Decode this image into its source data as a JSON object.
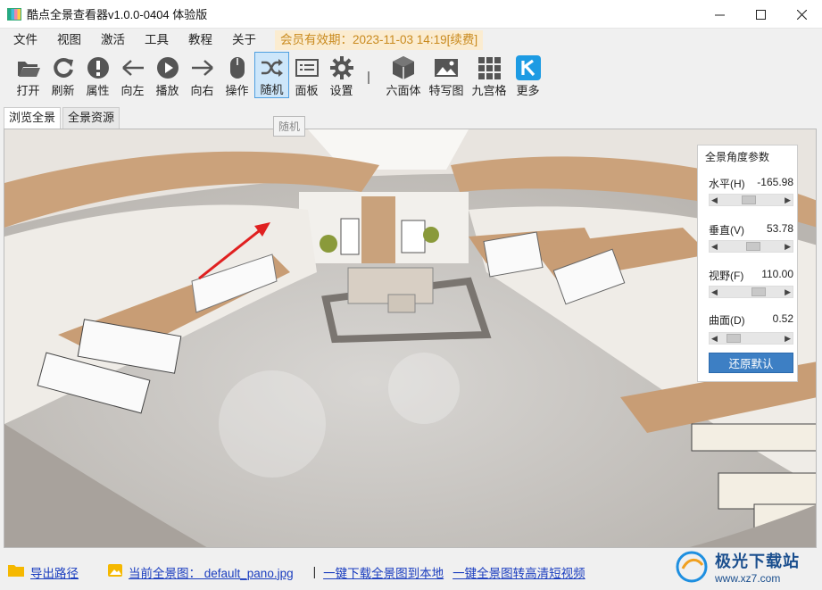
{
  "window": {
    "title": "酷点全景查看器v1.0.0-0404 体验版",
    "controls": [
      "minimize-icon",
      "maximize-icon",
      "close-icon"
    ]
  },
  "menu": {
    "items": [
      "文件",
      "视图",
      "激活",
      "工具",
      "教程",
      "关于"
    ],
    "member": "会员有效期：2023-11-03 14:19[续费]"
  },
  "toolbar": {
    "items": [
      {
        "label": "打开",
        "icon": "folder-open-icon"
      },
      {
        "label": "刷新",
        "icon": "refresh-icon"
      },
      {
        "label": "属性",
        "icon": "info-icon"
      },
      {
        "label": "向左",
        "icon": "arrow-left-icon"
      },
      {
        "label": "播放",
        "icon": "play-icon"
      },
      {
        "label": "向右",
        "icon": "arrow-right-icon"
      },
      {
        "label": "操作",
        "icon": "mouse-icon"
      },
      {
        "label": "随机",
        "icon": "shuffle-icon",
        "active": true
      },
      {
        "label": "面板",
        "icon": "panel-icon"
      },
      {
        "label": "设置",
        "icon": "gear-icon"
      },
      {
        "label": "六面体",
        "icon": "cube-icon"
      },
      {
        "label": "特写图",
        "icon": "image-icon"
      },
      {
        "label": "九宫格",
        "icon": "grid-icon"
      },
      {
        "label": "更多",
        "icon": "k-logo-icon"
      }
    ],
    "tooltip": "随机",
    "accent": "#4f9fe0"
  },
  "tabs": [
    "浏览全景",
    "全景资源"
  ],
  "params": {
    "title": "全景角度参数",
    "rows": [
      {
        "label": "水平(H)",
        "value": "-165.98",
        "level": 0.44
      },
      {
        "label": "垂直(V)",
        "value": "53.78",
        "level": 0.55
      },
      {
        "label": "视野(F)",
        "value": "110.00",
        "level": 0.68
      },
      {
        "label": "曲面(D)",
        "value": "0.52",
        "level": 0.1
      }
    ],
    "reset": "还原默认"
  },
  "statusbar": {
    "export": "导出路径",
    "current": "当前全景图： default_pano.jpg",
    "sep": "|",
    "download": "一键下载全景图到本地",
    "convert": "一键全景图转高清短视频"
  },
  "watermark": {
    "name": "极光下载站",
    "url": "www.xz7.com"
  }
}
